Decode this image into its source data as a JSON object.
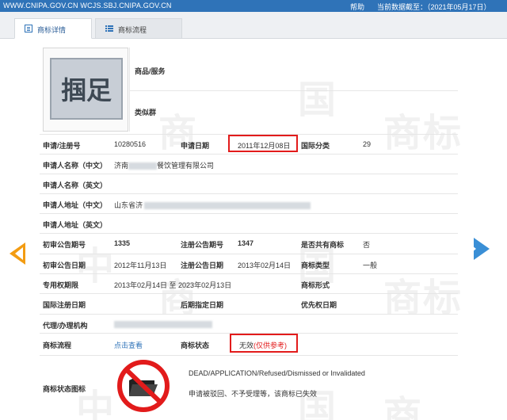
{
  "topbar": {
    "sites": "WWW.CNIPA.GOV.CN WCJS.SBJ.CNIPA.GOV.CN",
    "help": "帮助",
    "date": "当前数据截至：（2021年05月17日）"
  },
  "tabs": [
    {
      "label": "商标详情",
      "icon": "document-icon"
    },
    {
      "label": "商标流程",
      "icon": "list-icon"
    }
  ],
  "watermark": [
    "中",
    "国",
    "商",
    "标"
  ],
  "image_panel": {
    "logo_text": "掴足",
    "goods_label": "商品/服务",
    "similar_group_label": "类似群"
  },
  "fields": {
    "reg_no_label": "申请/注册号",
    "reg_no": "10280516",
    "app_date_label": "申请日期",
    "app_date": "2011年12月08日",
    "intl_class_label": "国际分类",
    "intl_class": "29",
    "applicant_cn_label": "申请人名称（中文）",
    "applicant_cn_prefix": "济南",
    "applicant_cn_suffix": "餐饮管理有限公司",
    "applicant_en_label": "申请人名称（英文）",
    "address_cn_label": "申请人地址（中文）",
    "address_cn_prefix": "山东省济",
    "address_en_label": "申请人地址（英文）",
    "prelim_no_label": "初审公告期号",
    "prelim_no": "1335",
    "reg_pub_no_label": "注册公告期号",
    "reg_pub_no": "1347",
    "shared_label": "是否共有商标",
    "shared": "否",
    "prelim_date_label": "初审公告日期",
    "prelim_date": "2012年11月13日",
    "reg_pub_date_label": "注册公告日期",
    "reg_pub_date": "2013年02月14日",
    "type_label": "商标类型",
    "type": "一般",
    "validity_label": "专用权期限",
    "validity": "2013年02月14日 至 2023年02月13日",
    "form_label": "商标形式",
    "intl_reg_date_label": "国际注册日期",
    "later_date_label": "后期指定日期",
    "priority_date_label": "优先权日期",
    "agent_label": "代理/办理机构",
    "process_label": "商标流程",
    "process_link": "点击查看",
    "status_label": "商标状态",
    "status_main": "无效",
    "status_note": "(仅供参考)",
    "status_icon_label": "商标状态图标",
    "status_en": "DEAD/APPLICATION/Refused/Dismissed or Invalidated",
    "status_cn": "申请被驳回、不予受理等，该商标已失效"
  },
  "colors": {
    "topbar": "#2f73b8",
    "highlight": "#e21b1b",
    "prev_arrow": "#f39c12",
    "next_arrow": "#3a8fd6"
  }
}
